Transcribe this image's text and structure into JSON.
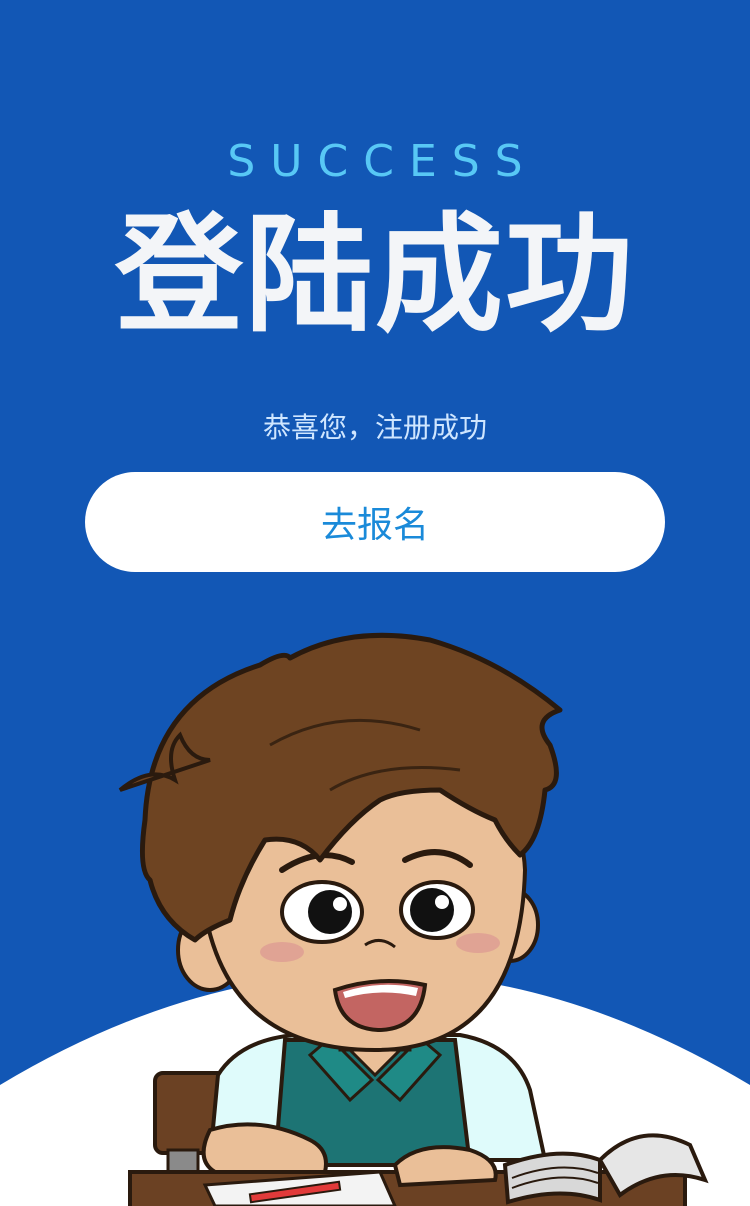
{
  "header": {
    "success_label": "SUCCESS",
    "title": "登陆成功",
    "subtitle": "恭喜您，注册成功"
  },
  "actions": {
    "signup_button_label": "去报名"
  },
  "colors": {
    "background": "#1257b5",
    "accent_text": "#58c8f5",
    "button_text": "#1a8ad9"
  },
  "illustration": {
    "icon": "cartoon-boy-studying"
  }
}
